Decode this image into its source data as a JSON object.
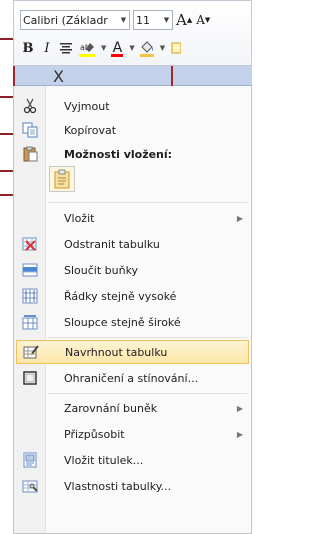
{
  "toolbar": {
    "font_name": "Calibri (Základr",
    "font_size": "11",
    "grow_font": "A",
    "shrink_font": "A",
    "bold": "B",
    "italic": "I",
    "highlight_colour": "#ffff00",
    "font_colour": "#ff0000",
    "shading_colour": "#f5c342"
  },
  "column_header": {
    "marker": "X"
  },
  "menu": {
    "items": [
      {
        "label": "Vyjmout",
        "icon": "scissors-icon"
      },
      {
        "label": "Kopírovat",
        "icon": "copy-icon"
      },
      {
        "label": "Možnosti vložení:",
        "icon": "paste-icon"
      },
      {
        "label": "Vložit",
        "icon": "",
        "submenu": true
      },
      {
        "label": "Odstranit tabulku",
        "icon": "delete-table-icon"
      },
      {
        "label": "Sloučit buňky",
        "icon": "merge-cells-icon"
      },
      {
        "label": "Řádky stejně vysoké",
        "icon": "distribute-rows-icon"
      },
      {
        "label": "Sloupce stejně široké",
        "icon": "distribute-columns-icon"
      },
      {
        "label": "Navrhnout tabulku",
        "icon": "draw-table-icon"
      },
      {
        "label": "Ohraničení a stínování...",
        "icon": "borders-shading-icon"
      },
      {
        "label": "Zarovnání buněk",
        "icon": "",
        "submenu": true
      },
      {
        "label": "Přizpůsobit",
        "icon": "",
        "submenu": true
      },
      {
        "label": "Vložit titulek...",
        "icon": "insert-caption-icon"
      },
      {
        "label": "Vlastnosti tabulky...",
        "icon": "table-properties-icon"
      }
    ],
    "highlighted_index": 8,
    "highlight_colour": "#fde7a8"
  }
}
